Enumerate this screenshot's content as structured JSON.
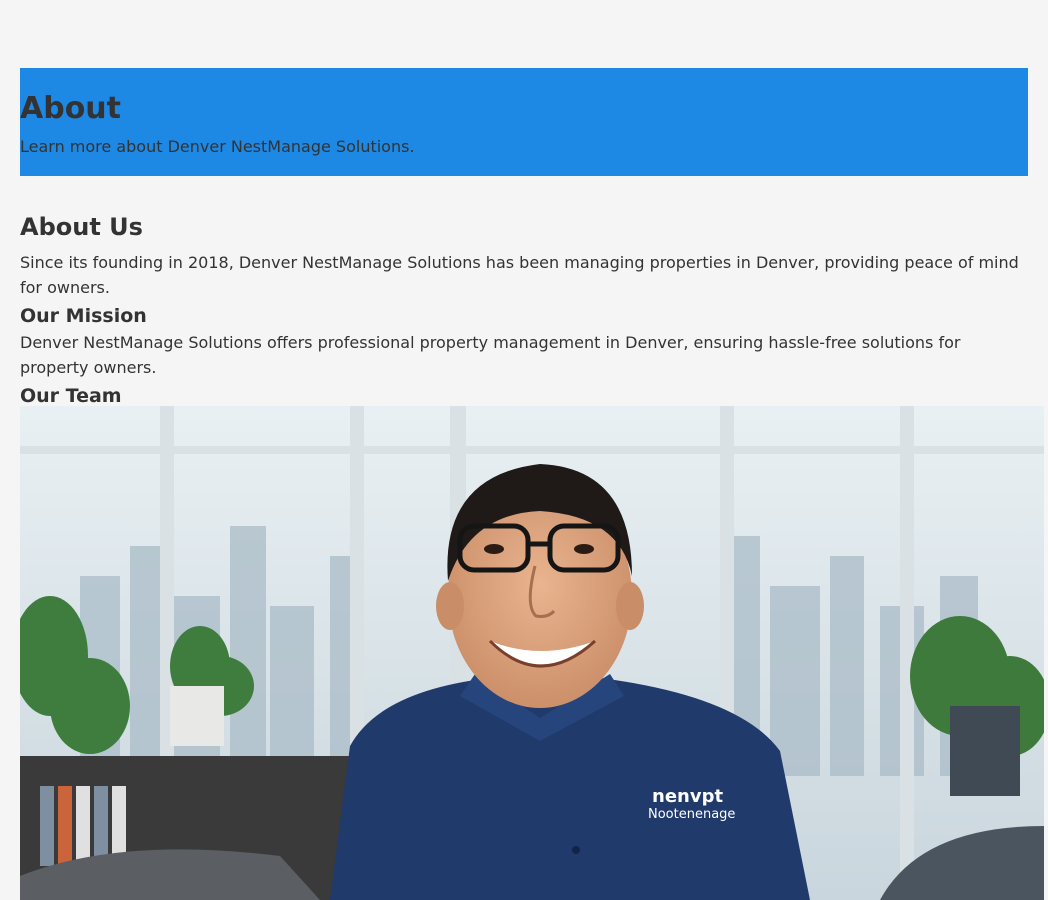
{
  "hero": {
    "title": "About",
    "subtitle": "Learn more about Denver NestManage Solutions."
  },
  "about_us": {
    "heading": "About Us",
    "text": "Since its founding in 2018, Denver NestManage Solutions has been managing properties in Denver, providing peace of mind for owners."
  },
  "mission": {
    "heading": "Our Mission",
    "text": "Denver NestManage Solutions offers professional property management in Denver, ensuring hassle-free solutions for property owners."
  },
  "team": {
    "heading": "Our Team",
    "photo_shirt_logo": "nenvpt Nootenenage"
  },
  "colors": {
    "hero_background": "#1e88e5",
    "page_background": "#f5f5f5",
    "text": "#333333",
    "shirt": "#1f3a6b"
  }
}
